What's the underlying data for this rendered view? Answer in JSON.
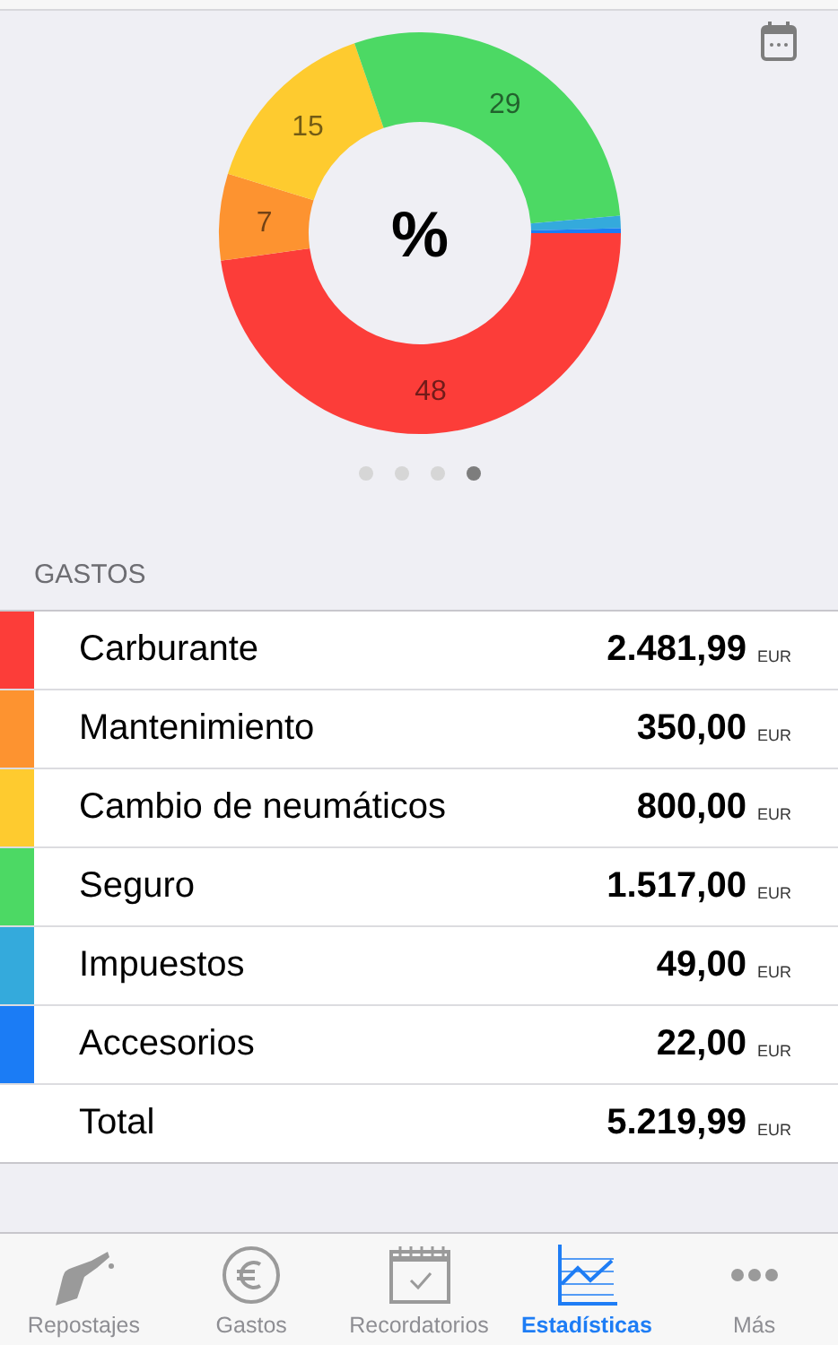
{
  "chart": {
    "center_label": "%",
    "chart_data": {
      "type": "donut",
      "values": [
        48,
        7,
        15,
        29,
        1,
        0.4
      ],
      "colors": [
        "#fc3d39",
        "#fd9330",
        "#fecb2f",
        "#4cd964",
        "#34aadc",
        "#1b7cf5"
      ],
      "value_labels": [
        "48",
        "7",
        "15",
        "29",
        null,
        null
      ]
    }
  },
  "pager": [
    {
      "selected": false
    },
    {
      "selected": false
    },
    {
      "selected": false
    },
    {
      "selected": true
    }
  ],
  "section_header": "GASTOS",
  "expenses": [
    {
      "name": "Carburante",
      "amount": "2.481,99",
      "currency": "EUR",
      "color": "#fc3d39"
    },
    {
      "name": "Mantenimiento",
      "amount": "350,00",
      "currency": "EUR",
      "color": "#fd9330"
    },
    {
      "name": "Cambio de neumáticos",
      "amount": "800,00",
      "currency": "EUR",
      "color": "#fecb2f"
    },
    {
      "name": "Seguro",
      "amount": "1.517,00",
      "currency": "EUR",
      "color": "#4cd964"
    },
    {
      "name": "Impuestos",
      "amount": "49,00",
      "currency": "EUR",
      "color": "#34aadc"
    },
    {
      "name": "Accesorios",
      "amount": "22,00",
      "currency": "EUR",
      "color": "#1b7cf5"
    }
  ],
  "total": {
    "name": "Total",
    "amount": "5.219,99",
    "currency": "EUR"
  },
  "tab_bar": [
    {
      "label": "Repostajes",
      "kind": "fuel",
      "selected": false
    },
    {
      "label": "Gastos",
      "kind": "euro",
      "selected": false
    },
    {
      "label": "Recordatorios",
      "kind": "calendar",
      "selected": false
    },
    {
      "label": "Estadísticas",
      "kind": "chart",
      "selected": true
    },
    {
      "label": "Más",
      "kind": "more",
      "selected": false
    }
  ]
}
